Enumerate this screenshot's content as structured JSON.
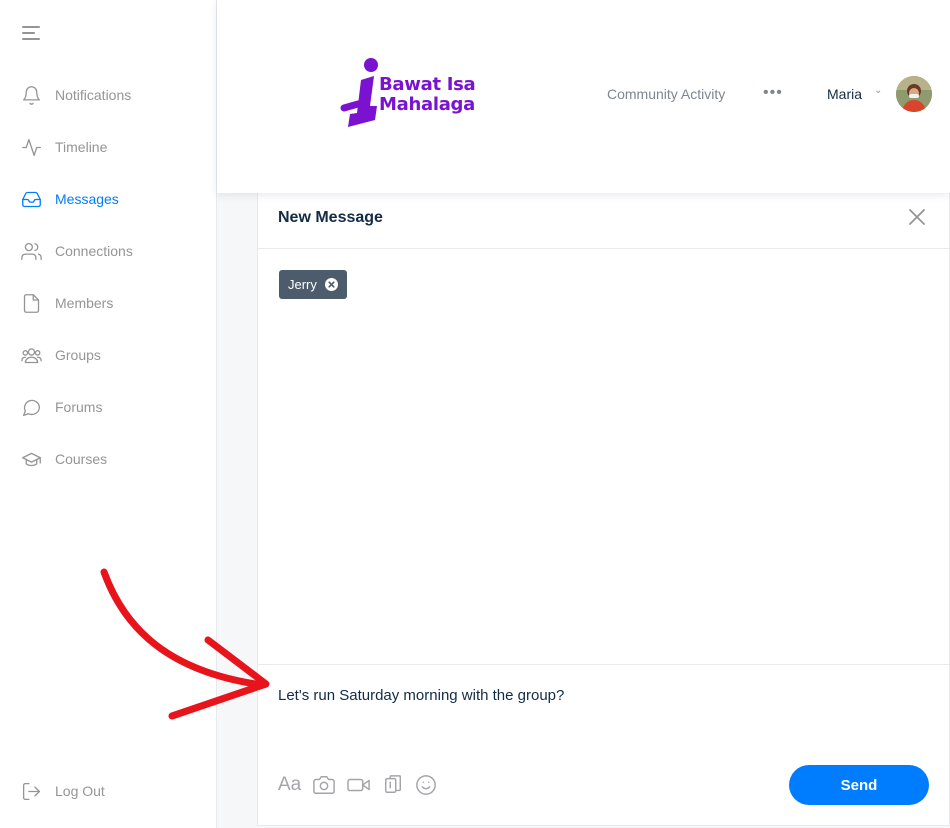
{
  "sidebar": {
    "items": [
      {
        "label": "Notifications",
        "icon": "bell-icon",
        "active": false
      },
      {
        "label": "Timeline",
        "icon": "activity-icon",
        "active": false
      },
      {
        "label": "Messages",
        "icon": "inbox-icon",
        "active": true
      },
      {
        "label": "Connections",
        "icon": "users-icon",
        "active": false
      },
      {
        "label": "Members",
        "icon": "file-icon",
        "active": false
      },
      {
        "label": "Groups",
        "icon": "group-icon",
        "active": false
      },
      {
        "label": "Forums",
        "icon": "chat-bubble-icon",
        "active": false
      },
      {
        "label": "Courses",
        "icon": "graduation-cap-icon",
        "active": false
      }
    ],
    "logout_label": "Log Out"
  },
  "header": {
    "logo_line1": "Bawat Isa",
    "logo_line2": "Mahalaga",
    "community_activity": "Community Activity",
    "more": "•••",
    "user_name": "Maria"
  },
  "panel": {
    "title": "New Message",
    "recipient": "Jerry",
    "message": "Let's run Saturday morning with the group?",
    "send_label": "Send",
    "format_label": "Aa"
  },
  "colors": {
    "accent": "#007cff",
    "brand": "#7a12cf",
    "annotation": "#e8141c"
  }
}
